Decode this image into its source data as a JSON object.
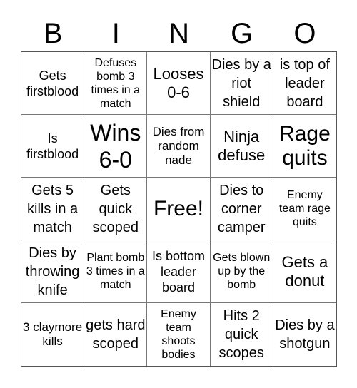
{
  "header": [
    "B",
    "I",
    "N",
    "G",
    "O"
  ],
  "cells": [
    "Gets firstblood",
    "Defuses bomb 3 times in a match",
    "Looses 0-6",
    "Dies by a riot shield",
    "is top of leader board",
    "Is firstblood",
    "Wins 6-0",
    "Dies from random nade",
    "Ninja defuse",
    "Rage quits",
    "Gets 5 kills in a match",
    "Gets quick scoped",
    "Free!",
    "Dies to corner camper",
    "Enemy team rage quits",
    "Dies by throwing knife",
    "Plant bomb 3 times in a match",
    "Is bottom leader board",
    "Gets blown up by the bomb",
    "Gets a donut",
    "3 claymore kills",
    "gets hard scoped",
    "Enemy team shoots bodies",
    "Hits 2 quick scopes",
    "Dies by a shotgun"
  ]
}
